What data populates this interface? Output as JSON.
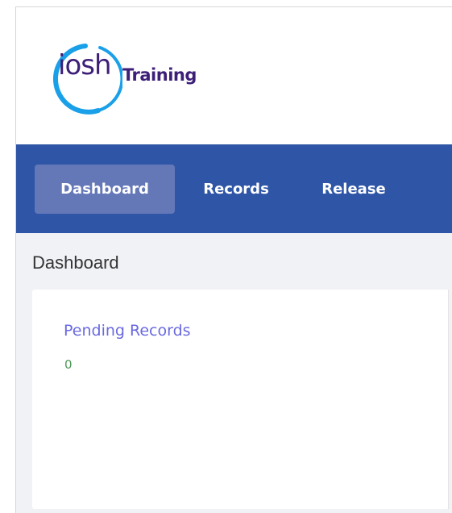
{
  "header": {
    "logo": {
      "mark_text": "iosh",
      "brand_text": "Training"
    }
  },
  "nav": {
    "items": [
      {
        "label": "Dashboard",
        "active": true
      },
      {
        "label": "Records",
        "active": false
      },
      {
        "label": "Release",
        "active": false
      }
    ]
  },
  "main": {
    "page_title": "Dashboard",
    "card": {
      "title": "Pending Records",
      "value": "0"
    }
  },
  "colors": {
    "nav_bg": "#2e55a6",
    "nav_active_bg": "#6478b8",
    "brand_purple": "#3d1f78",
    "ring_blue": "#1aa0e8",
    "card_title": "#6a6ae0",
    "card_value": "#4f9a5a",
    "content_bg": "#f1f2f6"
  }
}
